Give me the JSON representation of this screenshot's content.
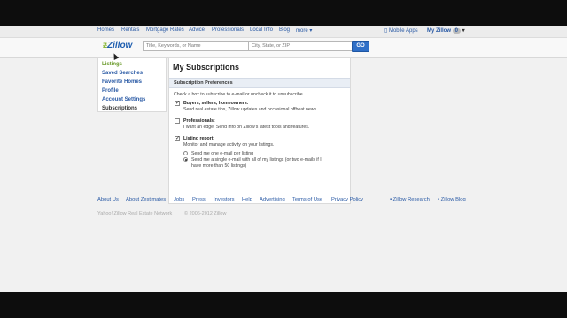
{
  "topnav": {
    "items": [
      "Homes",
      "Rentals",
      "Mortgage Rates",
      "Advice",
      "Professionals",
      "Local Info",
      "Blog",
      "more ▾"
    ],
    "mobile_apps": "Mobile Apps",
    "my_zillow": "My Zillow",
    "my_zillow_badge": "0"
  },
  "header": {
    "logo": "Zillow",
    "search_placeholder": "Title, Keywords, or Name",
    "location_placeholder": "City, State, or ZIP",
    "go_label": "GO"
  },
  "sidebar": {
    "items": [
      "Listings",
      "Saved Searches",
      "Favorite Homes",
      "Profile",
      "Account Settings",
      "Subscriptions"
    ]
  },
  "main": {
    "title": "My Subscriptions",
    "subhead": "Subscription Preferences",
    "intro": "Check a box to subscribe to e-mail or uncheck it to unsubscribe",
    "options": [
      {
        "label": "Buyers, sellers, homeowners:",
        "desc": "Send real estate tips, Zillow updates and occasional offbeat news.",
        "checked": true
      },
      {
        "label": "Professionals:",
        "desc": "I want an edge. Send info on Zillow's latest tools and features.",
        "checked": false
      },
      {
        "label": "Listing report:",
        "desc": "Monitor and manage activity on your listings.",
        "checked": true
      }
    ],
    "radio1": "Send me one e-mail per listing",
    "radio2_line1": "Send me a single e-mail with all of my listings (or two e-mails if I",
    "radio2_line2": "have more than 50 listings)"
  },
  "footer": {
    "links": [
      "About Us",
      "About Zestimates",
      "Jobs",
      "Press",
      "Investors",
      "Help",
      "Advertising",
      "Terms of Use",
      "Privacy Policy"
    ],
    "research": "Zillow Research",
    "blog": "Zillow Blog",
    "network": "Yahoo! Zillow Real Estate Network",
    "copyright": "© 2006-2012 Zillow"
  },
  "colors": {
    "link": "#2a5aa5",
    "selected": "#6a9a2a",
    "go_button": "#2f6fc7"
  }
}
